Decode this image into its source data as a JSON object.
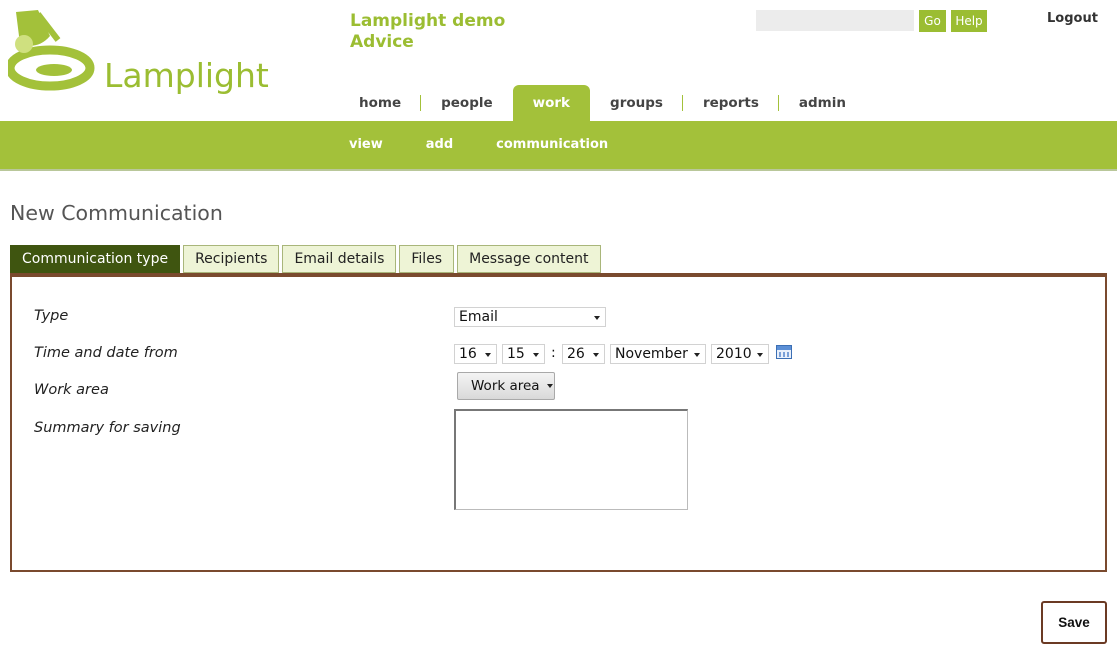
{
  "app": {
    "logo_text": "Lamplight",
    "org_name": "Lamplight demo Advice"
  },
  "header": {
    "search_value": "",
    "go_label": "Go",
    "help_label": "Help",
    "logout_label": "Logout"
  },
  "main_nav": [
    {
      "label": "home",
      "active": false
    },
    {
      "label": "people",
      "active": false
    },
    {
      "label": "work",
      "active": true
    },
    {
      "label": "groups",
      "active": false
    },
    {
      "label": "reports",
      "active": false
    },
    {
      "label": "admin",
      "active": false
    }
  ],
  "sub_nav": [
    {
      "label": "view"
    },
    {
      "label": "add"
    },
    {
      "label": "communication"
    }
  ],
  "page": {
    "title": "New Communication"
  },
  "tabs": [
    {
      "label": "Communication type",
      "active": true
    },
    {
      "label": "Recipients",
      "active": false
    },
    {
      "label": "Email details",
      "active": false
    },
    {
      "label": "Files",
      "active": false
    },
    {
      "label": "Message content",
      "active": false
    }
  ],
  "form": {
    "type_label": "Type",
    "type_value": "Email",
    "datetime_label": "Time and date from",
    "hour": "16",
    "minute": "15",
    "time_separator": ":",
    "day": "26",
    "month": "November",
    "year": "2010",
    "work_area_label": "Work area",
    "work_area_button": "Work area",
    "summary_label": "Summary for saving",
    "summary_value": ""
  },
  "actions": {
    "save_label": "Save"
  },
  "colors": {
    "brand_green": "#a3c13a",
    "active_tab": "#3f5510",
    "panel_border": "#7a4a2e"
  }
}
